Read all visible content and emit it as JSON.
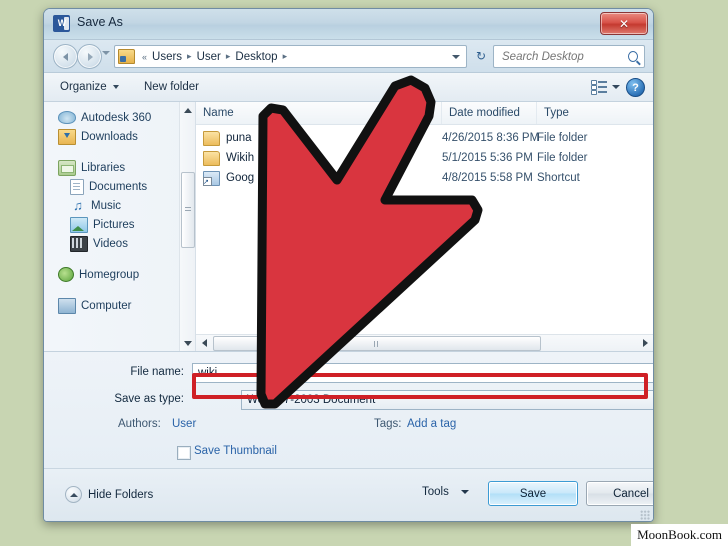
{
  "window": {
    "title": "Save As",
    "app_icon": "word-icon",
    "close_label": "✕"
  },
  "nav": {
    "back_icon": "back-arrow-icon",
    "forward_icon": "forward-arrow-icon",
    "history_icon": "chevron-down-icon",
    "folder_icon": "folder-icon",
    "breadcrumb_prefix": "«",
    "breadcrumbs": [
      "Users",
      "User",
      "Desktop"
    ],
    "separator": "▸",
    "dropdown_icon": "chevron-down-icon",
    "refresh_icon": "refresh-icon",
    "refresh_glyph": "↻"
  },
  "search": {
    "placeholder": "Search Desktop",
    "value": "",
    "icon": "search-icon"
  },
  "toolbar": {
    "organize_label": "Organize",
    "new_folder_label": "New folder",
    "view_icon": "view-mode-icon",
    "view_caret_icon": "chevron-down-icon",
    "help_icon": "help-icon",
    "help_glyph": "?"
  },
  "sidebar": {
    "items": [
      {
        "label": "Autodesk 360",
        "icon": "cloud-icon",
        "indent": false
      },
      {
        "label": "Downloads",
        "icon": "downloads-icon",
        "indent": false
      },
      {
        "label": "Libraries",
        "icon": "libraries-icon",
        "indent": false
      },
      {
        "label": "Documents",
        "icon": "document-icon",
        "indent": true
      },
      {
        "label": "Music",
        "icon": "music-icon",
        "indent": true
      },
      {
        "label": "Pictures",
        "icon": "picture-icon",
        "indent": true
      },
      {
        "label": "Videos",
        "icon": "video-icon",
        "indent": true
      },
      {
        "label": "Homegroup",
        "icon": "homegroup-icon",
        "indent": false
      },
      {
        "label": "Computer",
        "icon": "computer-icon",
        "indent": false
      }
    ],
    "scrollbar": {
      "up_icon": "scroll-up-icon",
      "down_icon": "scroll-down-icon"
    }
  },
  "filelist": {
    "columns": [
      "Name",
      "Date modified",
      "Type"
    ],
    "rows": [
      {
        "name": "puna",
        "date": "4/26/2015 8:36 PM",
        "type": "File folder",
        "icon": "folder-icon"
      },
      {
        "name": "Wikih",
        "date": "5/1/2015 5:36 PM",
        "type": "File folder",
        "icon": "folder-icon"
      },
      {
        "name": "Goog",
        "date": "4/8/2015 5:58 PM",
        "type": "Shortcut",
        "icon": "shortcut-icon"
      }
    ],
    "hscroll": {
      "left_icon": "scroll-left-icon",
      "right_icon": "scroll-right-icon"
    }
  },
  "form": {
    "file_name_label": "File name:",
    "file_name_value": "wiki",
    "save_as_type_label": "Save as type:",
    "save_as_type_value": "Word 97-2003 Document",
    "authors_label": "Authors:",
    "authors_value": "User",
    "tags_label": "Tags:",
    "tags_value": "Add a tag",
    "save_thumbnail_label": "Save Thumbnail",
    "save_thumbnail_checked": false,
    "dropdown_icon": "chevron-down-icon"
  },
  "footer": {
    "hide_folders_label": "Hide Folders",
    "hide_folders_icon": "collapse-icon",
    "tools_label": "Tools",
    "tools_caret_icon": "chevron-down-icon",
    "save_label": "Save",
    "cancel_label": "Cancel",
    "resize_grip_icon": "resize-grip-icon"
  },
  "annotation": {
    "arrow_icon": "red-pointer-arrow",
    "arrow_fill": "#d9353f",
    "arrow_stroke": "#111111",
    "highlight_icon": "red-highlight-box",
    "highlight_color": "#cf2026",
    "target": "Word 97-2003 Document"
  },
  "watermark": {
    "text": "MoonBook.com"
  },
  "colors": {
    "page_background": "#c8d5b2",
    "accent_blue": "#2a63a8",
    "annotation_red": "#cf2026"
  }
}
